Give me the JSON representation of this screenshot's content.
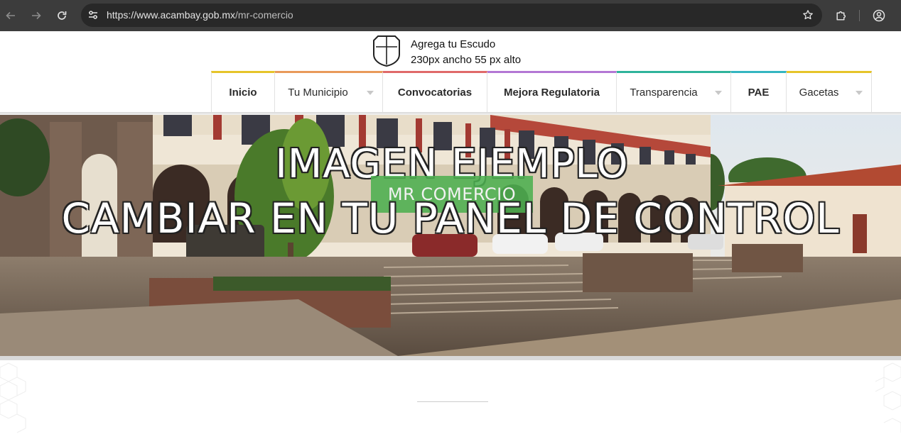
{
  "browser": {
    "url_host": "https://www.acambay.gob.mx",
    "url_path": "/mr-comercio"
  },
  "header": {
    "escudo_line1": "Agrega tu Escudo",
    "escudo_line2": "230px ancho 55 px alto"
  },
  "menu": {
    "items": [
      {
        "label": "Inicio",
        "color": "#e6c42a",
        "has_caret": false
      },
      {
        "label": "Tu Municipio",
        "color": "#e99a5a",
        "has_caret": true
      },
      {
        "label": "Convocatorias",
        "color": "#e06a6a",
        "has_caret": false
      },
      {
        "label": "Mejora Regulatoria",
        "color": "#b377d4",
        "has_caret": false
      },
      {
        "label": "Transparencia",
        "color": "#2fb39b",
        "has_caret": true
      },
      {
        "label": "PAE",
        "color": "#34b5c0",
        "has_caret": false
      },
      {
        "label": "Gacetas",
        "color": "#e6c42a",
        "has_caret": true
      }
    ]
  },
  "hero": {
    "line1": "IMAGEN EJEMPLO",
    "line2": "CAMBIAR EN TU PANEL DE CONTROL",
    "badge": "MR COMERCIO",
    "badge_color": "#4caf50"
  },
  "icons": {
    "back": "arrow-left-icon",
    "forward": "arrow-right-icon",
    "reload": "reload-icon",
    "site_info": "tune-icon",
    "bookmark": "star-icon",
    "extensions": "puzzle-icon",
    "profile": "account-icon",
    "shield": "shield-icon"
  }
}
